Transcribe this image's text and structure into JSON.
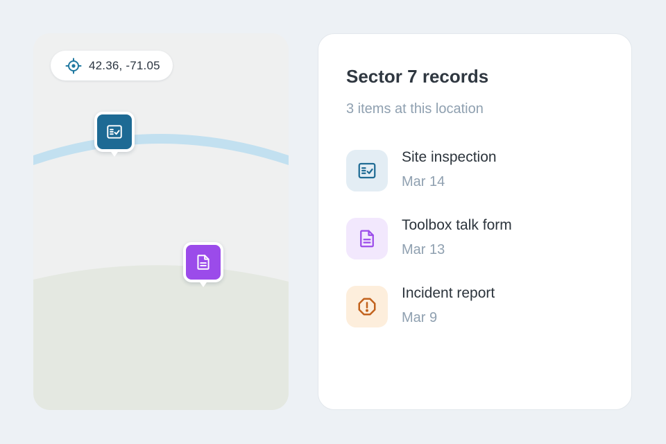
{
  "map": {
    "coordinates": "42.36, -71.05",
    "coordinate_icon": "crosshair-target-icon",
    "colors": {
      "background": "#eff0f0",
      "river": "#c2e0f0",
      "land": "#e4e8e1"
    },
    "pins": [
      {
        "name": "inspection",
        "icon": "checklist-icon",
        "color": "#1d6a94"
      },
      {
        "name": "toolbox-talk",
        "icon": "document-icon",
        "color": "#9b4bea"
      }
    ]
  },
  "panel": {
    "title": "Sector 7 records",
    "subtitle": "3 items at this location",
    "records": [
      {
        "title": "Site inspection",
        "date": "Mar 14",
        "icon": "checklist-icon",
        "icon_color": "#1f6b94",
        "icon_bg": "#e3edf4"
      },
      {
        "title": "Toolbox talk form",
        "date": "Mar 13",
        "icon": "document-icon",
        "icon_color": "#9b4bea",
        "icon_bg": "#f2e8fd"
      },
      {
        "title": "Incident report",
        "date": "Mar 9",
        "icon": "alert-circle-icon",
        "icon_color": "#c2621d",
        "icon_bg": "#fdeedc"
      }
    ]
  }
}
